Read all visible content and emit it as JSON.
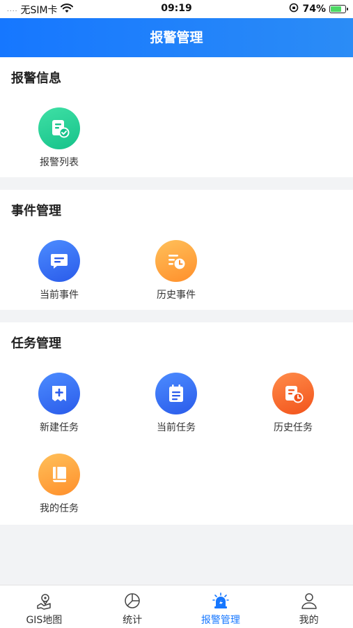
{
  "status_bar": {
    "signal_dots": "....",
    "carrier": "无SIM卡",
    "time": "09:19",
    "battery_percent": "74%",
    "battery_level": 0.74
  },
  "header": {
    "title": "报警管理"
  },
  "sections": {
    "alarm_info": {
      "title": "报警信息",
      "items": [
        {
          "label": "报警列表",
          "icon": "alarm-list-icon",
          "color": "#16c28a"
        }
      ]
    },
    "event_management": {
      "title": "事件管理",
      "items": [
        {
          "label": "当前事件",
          "icon": "message-icon",
          "color": "#2a5bea"
        },
        {
          "label": "历史事件",
          "icon": "history-list-icon",
          "color": "#ff8f2b"
        }
      ]
    },
    "task_management": {
      "title": "任务管理",
      "items": [
        {
          "label": "新建任务",
          "icon": "add-doc-icon",
          "color": "#2a5bea"
        },
        {
          "label": "当前任务",
          "icon": "calendar-icon",
          "color": "#2a5bea"
        },
        {
          "label": "历史任务",
          "icon": "history-doc-icon",
          "color": "#f2531b"
        },
        {
          "label": "我的任务",
          "icon": "book-icon",
          "color": "#ff8f2b"
        }
      ]
    }
  },
  "tab_bar": {
    "active_color": "#1677ff",
    "tabs": [
      {
        "label": "GIS地图",
        "icon": "map-icon",
        "active": false
      },
      {
        "label": "统计",
        "icon": "pie-chart-icon",
        "active": false
      },
      {
        "label": "报警管理",
        "icon": "siren-icon",
        "active": true
      },
      {
        "label": "我的",
        "icon": "user-icon",
        "active": false
      }
    ]
  }
}
